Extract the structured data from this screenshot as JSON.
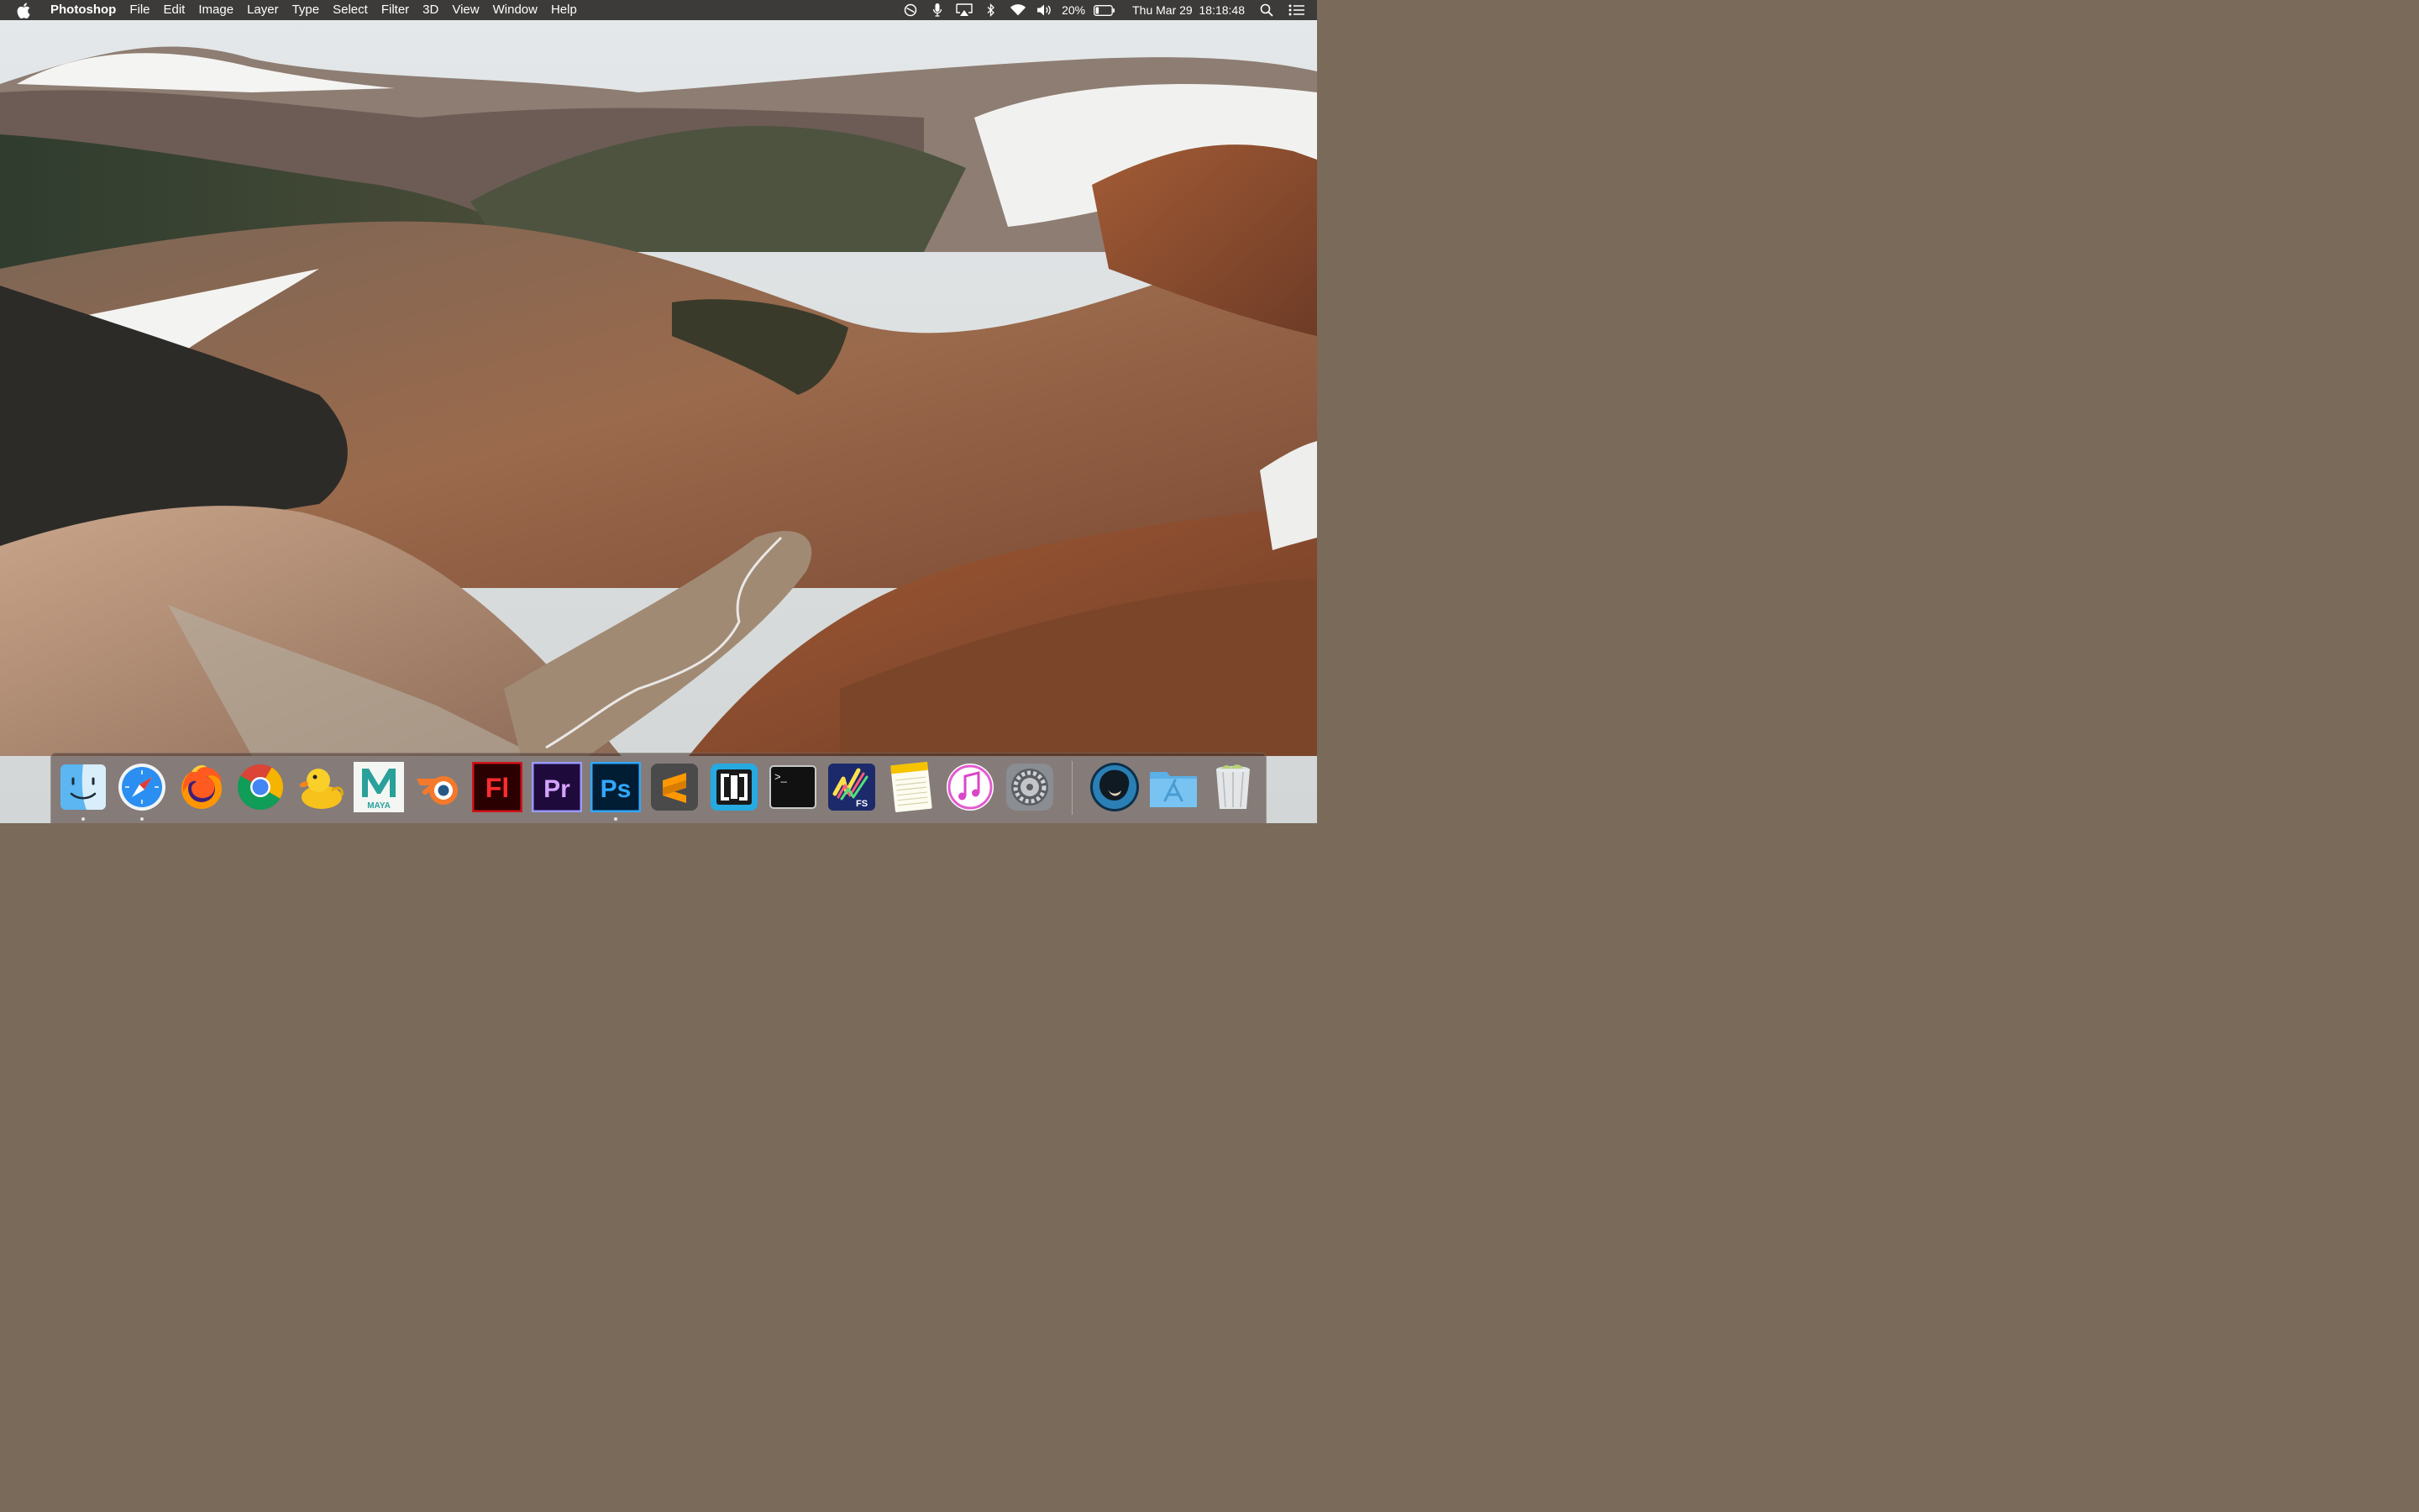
{
  "menubar": {
    "app_name": "Photoshop",
    "menus": [
      "File",
      "Edit",
      "Image",
      "Layer",
      "Type",
      "Select",
      "Filter",
      "3D",
      "View",
      "Window",
      "Help"
    ],
    "battery_percent": "20%",
    "datetime": "Thu Mar 29  18:18:48",
    "status_icons": [
      "do-not-disturb-icon",
      "microphone-icon",
      "airplay-icon",
      "bluetooth-icon",
      "wifi-icon",
      "volume-icon",
      "battery-icon",
      "spotlight-icon",
      "notification-center-icon"
    ]
  },
  "dock": {
    "apps": [
      {
        "name": "Finder",
        "icon": "finder-icon",
        "running": true
      },
      {
        "name": "Safari",
        "icon": "safari-icon",
        "running": true
      },
      {
        "name": "Firefox",
        "icon": "firefox-icon",
        "running": false
      },
      {
        "name": "Google Chrome",
        "icon": "chrome-icon",
        "running": false
      },
      {
        "name": "Cyberduck",
        "icon": "cyberduck-icon",
        "running": false
      },
      {
        "name": "Maya",
        "icon": "maya-icon",
        "label": "MAYA",
        "running": false
      },
      {
        "name": "Blender",
        "icon": "blender-icon",
        "running": false
      },
      {
        "name": "Flash",
        "icon": "flash-icon",
        "label": "Fl",
        "running": false
      },
      {
        "name": "Premiere Pro",
        "icon": "premiere-icon",
        "label": "Pr",
        "running": false
      },
      {
        "name": "Photoshop",
        "icon": "photoshop-icon",
        "label": "Ps",
        "running": true
      },
      {
        "name": "Sublime Text",
        "icon": "sublime-icon",
        "running": false
      },
      {
        "name": "Brackets",
        "icon": "brackets-icon",
        "running": false
      },
      {
        "name": "Terminal",
        "icon": "terminal-icon",
        "label": ">_",
        "running": false
      },
      {
        "name": "FS",
        "icon": "fs-icon",
        "label": "FS",
        "running": false
      },
      {
        "name": "Notes",
        "icon": "notes-icon",
        "running": false
      },
      {
        "name": "iTunes",
        "icon": "itunes-icon",
        "running": false
      },
      {
        "name": "System Preferences",
        "icon": "system-preferences-icon",
        "running": false
      },
      {
        "name": "User Folder",
        "icon": "user-folder-icon",
        "running": false
      },
      {
        "name": "Applications",
        "icon": "applications-folder-icon",
        "running": false
      },
      {
        "name": "Trash",
        "icon": "trash-icon",
        "running": false
      }
    ]
  },
  "colors": {
    "menubar_bg": "#3c3b3a",
    "flash_red": "#d1141b",
    "premiere_purple": "#9999ff",
    "photoshop_blue": "#31a8ff",
    "maya_teal": "#2aa09a"
  }
}
